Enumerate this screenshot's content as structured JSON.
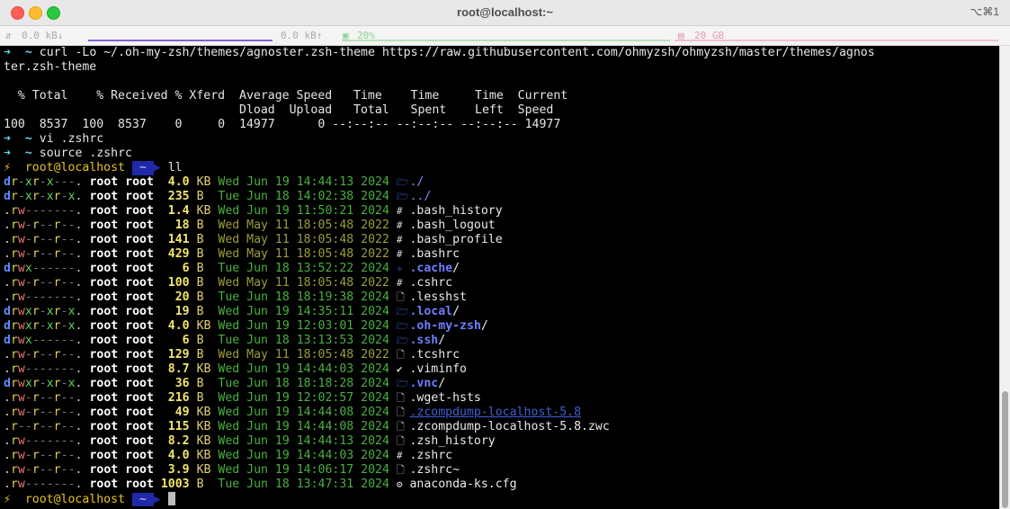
{
  "window": {
    "title": "root@localhost:~",
    "shortcut": "⌥⌘1"
  },
  "statusbar": {
    "net_down": "0.0 kB↓",
    "net_up": "0.0 kB↑",
    "cpu": "20%",
    "mem": "20 GB"
  },
  "terminal": {
    "cmd1": "curl -Lo ~/.oh-my-zsh/themes/agnoster.zsh-theme https://raw.githubusercontent.com/ohmyzsh/ohmyzsh/master/themes/agnos",
    "cmd1_wrap": "ter.zsh-theme",
    "curl_header1": "  % Total    % Received % Xferd  Average Speed   Time    Time     Time  Current",
    "curl_header2": "                                 Dload  Upload   Total   Spent    Left  Speed",
    "curl_row": "100  8537  100  8537    0     0  14977      0 --:--:-- --:--:-- --:--:-- 14977",
    "cmd2": "vi .zshrc",
    "cmd3": "source .zshrc",
    "prompt_user": "root@localhost",
    "prompt_dir": "~",
    "cmd4": "ll",
    "prompt_symbol": "⚡",
    "arrow": "➜",
    "tilde": "~"
  },
  "listing": [
    {
      "perms": "dr-xr-x---.",
      "owner": "root root",
      "size": "4.0",
      "unit": "KB",
      "date": "Wed Jun 19 14:44:13 2024",
      "icon": "folder",
      "name": "./",
      "kind": "dir-plain"
    },
    {
      "perms": "dr-xr-xr-x.",
      "owner": "root root",
      "size": "235",
      "unit": "B",
      "date": "Tue Jun 18 14:02:38 2024",
      "icon": "folder",
      "name": "../",
      "kind": "dir-plain"
    },
    {
      "perms": ".rw-------.",
      "owner": "root root",
      "size": "1.4",
      "unit": "KB",
      "date": "Wed Jun 19 11:50:21 2024",
      "icon": "hash",
      "name": ".bash_history",
      "kind": "file"
    },
    {
      "perms": ".rw-r--r--.",
      "owner": "root root",
      "size": "18",
      "unit": "B",
      "date": "Wed May 11 18:05:48 2022",
      "icon": "hash",
      "name": ".bash_logout",
      "kind": "file",
      "old": true
    },
    {
      "perms": ".rw-r--r--.",
      "owner": "root root",
      "size": "141",
      "unit": "B",
      "date": "Wed May 11 18:05:48 2022",
      "icon": "hash",
      "name": ".bash_profile",
      "kind": "file",
      "old": true
    },
    {
      "perms": ".rw-r--r--.",
      "owner": "root root",
      "size": "429",
      "unit": "B",
      "date": "Wed May 11 18:05:48 2022",
      "icon": "hash",
      "name": ".bashrc",
      "kind": "file",
      "old": true
    },
    {
      "perms": "drwx------.",
      "owner": "root root",
      "size": "6",
      "unit": "B",
      "date": "Tue Jun 18 13:52:22 2024",
      "icon": "cache",
      "name": ".cache",
      "kind": "dir"
    },
    {
      "perms": ".rw-r--r--.",
      "owner": "root root",
      "size": "100",
      "unit": "B",
      "date": "Wed May 11 18:05:48 2022",
      "icon": "hash",
      "name": ".cshrc",
      "kind": "file",
      "old": true
    },
    {
      "perms": ".rw-------.",
      "owner": "root root",
      "size": "20",
      "unit": "B",
      "date": "Tue Jun 18 18:19:38 2024",
      "icon": "file",
      "name": ".lesshst",
      "kind": "file"
    },
    {
      "perms": "drwxr-xr-x.",
      "owner": "root root",
      "size": "19",
      "unit": "B",
      "date": "Wed Jun 19 14:35:11 2024",
      "icon": "folder",
      "name": ".local",
      "kind": "dir"
    },
    {
      "perms": "drwxr-xr-x.",
      "owner": "root root",
      "size": "4.0",
      "unit": "KB",
      "date": "Wed Jun 19 12:03:01 2024",
      "icon": "folder",
      "name": ".oh-my-zsh",
      "kind": "dir"
    },
    {
      "perms": "drwx------.",
      "owner": "root root",
      "size": "6",
      "unit": "B",
      "date": "Tue Jun 18 13:13:53 2024",
      "icon": "folder",
      "name": ".ssh",
      "kind": "dir"
    },
    {
      "perms": ".rw-r--r--.",
      "owner": "root root",
      "size": "129",
      "unit": "B",
      "date": "Wed May 11 18:05:48 2022",
      "icon": "file",
      "name": ".tcshrc",
      "kind": "file",
      "old": true
    },
    {
      "perms": ".rw-------.",
      "owner": "root root",
      "size": "8.7",
      "unit": "KB",
      "date": "Wed Jun 19 14:44:03 2024",
      "icon": "vim",
      "name": ".viminfo",
      "kind": "file"
    },
    {
      "perms": "drwxr-xr-x.",
      "owner": "root root",
      "size": "36",
      "unit": "B",
      "date": "Tue Jun 18 18:18:28 2024",
      "icon": "folder",
      "name": ".vnc",
      "kind": "dir"
    },
    {
      "perms": ".rw-r--r--.",
      "owner": "root root",
      "size": "216",
      "unit": "B",
      "date": "Wed Jun 19 12:02:57 2024",
      "icon": "file",
      "name": ".wget-hsts",
      "kind": "file"
    },
    {
      "perms": ".rw-r--r--.",
      "owner": "root root",
      "size": "49",
      "unit": "KB",
      "date": "Wed Jun 19 14:44:08 2024",
      "icon": "file",
      "name": ".zcompdump-localhost-5.8",
      "kind": "link"
    },
    {
      "perms": ".r--r--r--.",
      "owner": "root root",
      "size": "115",
      "unit": "KB",
      "date": "Wed Jun 19 14:44:08 2024",
      "icon": "file",
      "name": ".zcompdump-localhost-5.8.zwc",
      "kind": "file"
    },
    {
      "perms": ".rw-------.",
      "owner": "root root",
      "size": "8.2",
      "unit": "KB",
      "date": "Wed Jun 19 14:44:13 2024",
      "icon": "file",
      "name": ".zsh_history",
      "kind": "file"
    },
    {
      "perms": ".rw-r--r--.",
      "owner": "root root",
      "size": "4.0",
      "unit": "KB",
      "date": "Wed Jun 19 14:44:03 2024",
      "icon": "hash",
      "name": ".zshrc",
      "kind": "file"
    },
    {
      "perms": ".rw-r--r--.",
      "owner": "root root",
      "size": "3.9",
      "unit": "KB",
      "date": "Wed Jun 19 14:06:17 2024",
      "icon": "file",
      "name": ".zshrc~",
      "kind": "file"
    },
    {
      "perms": ".rw-------.",
      "owner": "root root",
      "size": "1003",
      "unit": "B",
      "date": "Tue Jun 18 13:47:31 2024",
      "icon": "gear",
      "name": "anaconda-ks.cfg",
      "kind": "file"
    }
  ],
  "colors": {
    "terminal_bg": "#000000",
    "prompt_dir_bg": "#1f28a8",
    "date": "#49b03e",
    "size": "#f3e56a",
    "dir_name": "#6f7eff"
  }
}
